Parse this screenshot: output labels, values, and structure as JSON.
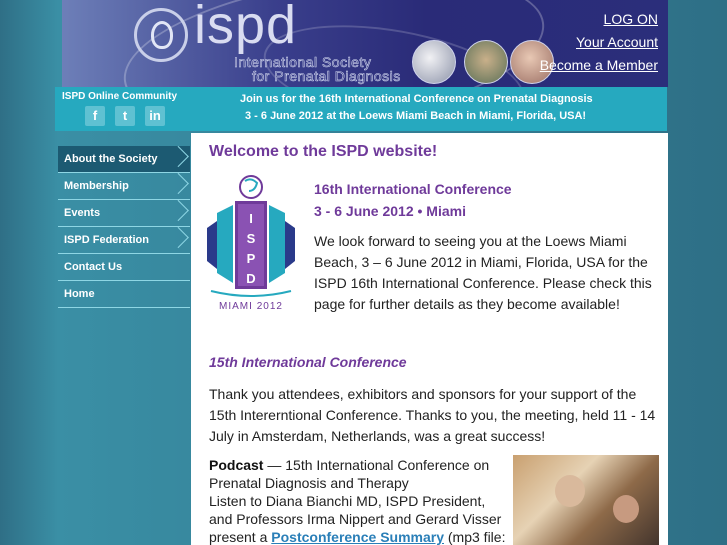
{
  "header": {
    "logo_text": "ispd",
    "logo_sub_line1": "International Society",
    "logo_sub_line2": "for Prenatal Diagnosis",
    "links": {
      "login": "LOG ON",
      "account": "Your Account",
      "member": "Become a Member"
    }
  },
  "banner": {
    "community_label": "ISPD Online Community",
    "social": {
      "facebook": "f",
      "twitter": "t",
      "linkedin": "in"
    },
    "line1": "Join us for the 16th International Conference on Prenatal Diagnosis",
    "line2": "3 - 6 June 2012 at the Loews Miami Beach in Miami, Florida, USA!"
  },
  "sidebar": {
    "items": [
      {
        "label": "About the Society",
        "active": true
      },
      {
        "label": "Membership"
      },
      {
        "label": "Events"
      },
      {
        "label": "ISPD Federation"
      },
      {
        "label": "Contact Us"
      },
      {
        "label": "Home"
      }
    ]
  },
  "main": {
    "welcome": "Welcome to the ISPD website!",
    "conf_logo": {
      "letters": [
        "I",
        "S",
        "P",
        "D"
      ],
      "caption": "MIAMI 2012"
    },
    "conf_title": "16th International Conference",
    "conf_date": "3 - 6 June 2012  •  Miami",
    "conf_para": "We look forward to seeing you at the Loews Miami Beach, 3 – 6 June 2012 in Miami, Florida, USA for the ISPD 16th International Conference. Please check this page for further details as they become available!",
    "h15": "15th International Conference",
    "para15": "Thank you attendees, exhibitors and sponsors for your support of the 15th Intererntional Conference. Thanks to you, the meeting, held 11 - 14 July in Amsterdam, Netherlands, was a great success!",
    "podcast": {
      "label": "Podcast",
      "text1": " — 15th International Conference on Prenatal Diagnosis and Therapy",
      "text2": "Listen to Diana Bianchi MD, ISPD President, and Professors Irma Nippert and Gerard Visser present a ",
      "link": "Postconference Summary",
      "text3": " (mp3 file:"
    }
  },
  "colors": {
    "header_bg": "#2b2e7b",
    "banner_teal": "#26a9bf",
    "sidebar_bg": "#2e6f86",
    "heading_purple": "#6f3a9a",
    "link_blue": "#2a7fb8"
  }
}
